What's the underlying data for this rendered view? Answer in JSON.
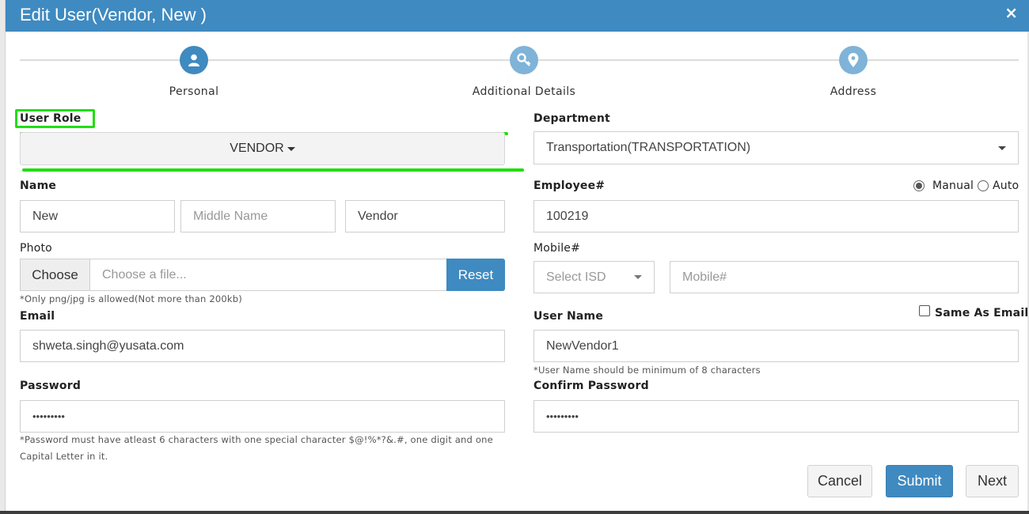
{
  "dialog": {
    "title": "Edit User(Vendor, New )",
    "close_icon": "×"
  },
  "steps": [
    {
      "label": "Personal",
      "icon": "user-icon"
    },
    {
      "label": "Additional Details",
      "icon": "key-icon"
    },
    {
      "label": "Address",
      "icon": "map-marker-icon"
    }
  ],
  "form": {
    "user_role": {
      "label": "User Role",
      "value": "VENDOR"
    },
    "department": {
      "label": "Department",
      "value": "Transportation(TRANSPORTATION)"
    },
    "name": {
      "label": "Name",
      "first": "New",
      "middle_placeholder": "Middle Name",
      "last": "Vendor"
    },
    "employee": {
      "label": "Employee#",
      "value": "100219",
      "mode_manual": "Manual",
      "mode_auto": "Auto",
      "selected_mode": "Manual"
    },
    "photo": {
      "label": "Photo",
      "choose": "Choose",
      "placeholder": "Choose a file...",
      "reset": "Reset",
      "hint": "*Only png/jpg is allowed(Not more than 200kb)"
    },
    "mobile": {
      "label": "Mobile#",
      "isd_placeholder": "Select ISD",
      "placeholder": "Mobile#"
    },
    "email": {
      "label": "Email",
      "value": "shweta.singh@yusata.com"
    },
    "username": {
      "label": "User Name",
      "value": "NewVendor1",
      "same_as_email": "Same As Email",
      "hint": "*User Name should be minimum of 8 characters"
    },
    "password": {
      "label": "Password",
      "value": "•••••••••",
      "hint_line1": "*Password must have atleast 6 characters with one special character $@!%*?&.#, one digit and one",
      "hint_line2": "Capital Letter in it."
    },
    "confirm_password": {
      "label": "Confirm Password",
      "value": "•••••••••"
    }
  },
  "actions": {
    "cancel": "Cancel",
    "submit": "Submit",
    "next": "Next"
  },
  "colors": {
    "header": "#3f8ac0",
    "primary": "#3f8ac0",
    "highlight": "#22dd11"
  }
}
